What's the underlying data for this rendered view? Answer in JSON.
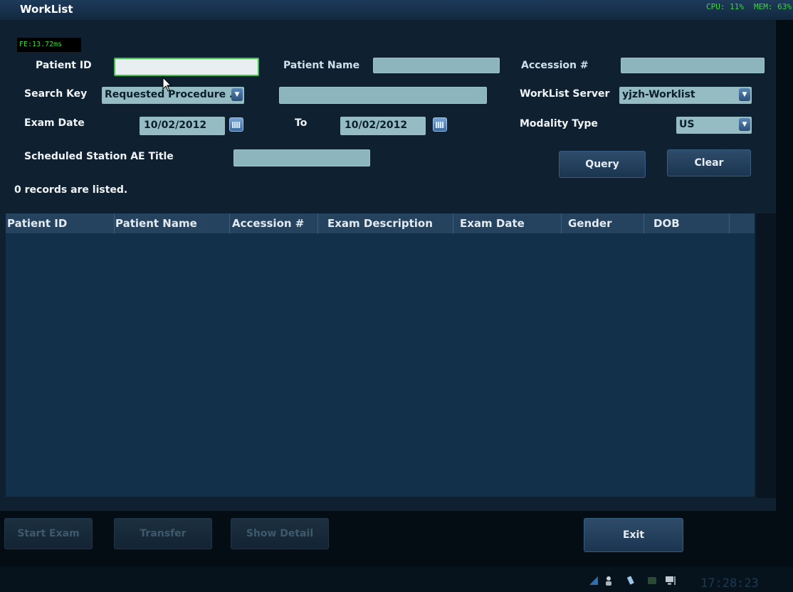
{
  "window": {
    "title": "WorkList",
    "cpu": "CPU: 11%",
    "mem": "MEM: 63%",
    "frame_time": "FE:13.72ms"
  },
  "form": {
    "patient_id_label": "Patient ID",
    "patient_id_value": "",
    "patient_name_label": "Patient Name",
    "accession_label": "Accession #",
    "search_key_label": "Search Key",
    "search_key_value": "Requested Procedure ...",
    "worklist_server_label": "WorkList Server",
    "worklist_server_value": "yjzh-Worklist",
    "exam_date_label": "Exam Date",
    "exam_date_from": "10/02/2012",
    "to_label": "To",
    "exam_date_to": "10/02/2012",
    "modality_type_label": "Modality Type",
    "modality_type_value": "US",
    "station_ae_label": "Scheduled Station AE Title",
    "query_label": "Query",
    "clear_label": "Clear",
    "records_status": "0 records are listed."
  },
  "table": {
    "columns": [
      "Patient ID",
      "Patient Name",
      "Accession #",
      "Exam Description",
      "Exam Date",
      "Gender",
      "DOB"
    ],
    "rows": []
  },
  "footer": {
    "start_exam_label": "Start Exam",
    "transfer_label": "Transfer",
    "show_detail_label": "Show Detail",
    "exit_label": "Exit",
    "clock": "17:28:23"
  },
  "colors": {
    "background": "#050d14",
    "panel": "#0f2130",
    "field": "#8cb5bd",
    "active_border": "#41c24a",
    "status_green": "#3ad63a"
  },
  "icons": [
    "calendar-icon",
    "dropdown-arrow-icon",
    "mouse-cursor-icon",
    "user-icon",
    "usb-icon",
    "network-icon",
    "monitor-icon"
  ]
}
